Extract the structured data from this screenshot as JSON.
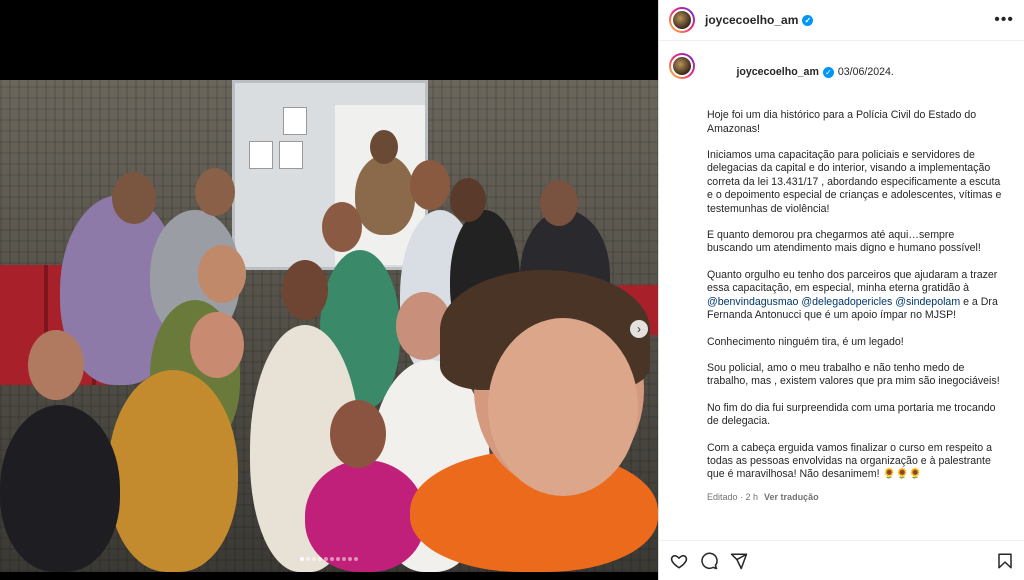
{
  "post": {
    "username": "joycecoelho_am",
    "date": "03/06/2024.",
    "paragraphs": [
      "Hoje foi um dia histórico para a Polícia Civil do Estado do Amazonas!",
      "Iniciamos uma capacitação para policiais e servidores de delegacias da capital e do interior, visando a implementação correta da lei 13.431/17 , abordando especificamente a escuta e o depoimento especial de crianças e adolescentes, vítimas e testemunhas de violência!",
      "E quanto demorou pra chegarmos até aqui…sempre buscando um atendimento mais digno e humano possível!"
    ],
    "gratitude": {
      "before": "Quanto orgulho eu tenho dos parceiros que ajudaram a trazer essa capacitação, em especial, minha eterna gratidão à ",
      "mention1": "@benvindagusmao",
      "mention2": "@delegadopericles",
      "mention3": "@sindepolam",
      "after": " e a Dra Fernanda Antonucci que é um apoio ímpar no MJSP!"
    },
    "paragraphs2": [
      "Conhecimento ninguém tira, é um legado!",
      "Sou policial, amo o meu trabalho e não tenho medo de trabalho, mas , existem valores que pra mim são inegociáveis!",
      "No fim do dia fui surpreendida com uma portaria me trocando de delegacia.",
      "Com a cabeça erguida vamos finalizar o curso em respeito a todas as pessoas envolvidas na organização e à palestrante que é maravilhosa! Não desanimem! 🌻🌻🌻"
    ],
    "edited": "Editado · 2 h",
    "see_translation": "Ver tradução"
  },
  "icons": [
    "more-icon",
    "verified-icon",
    "heart-icon",
    "comment-icon",
    "share-icon",
    "bookmark-icon",
    "next-arrow-icon"
  ],
  "carousel": {
    "total": 10,
    "active": 1
  }
}
